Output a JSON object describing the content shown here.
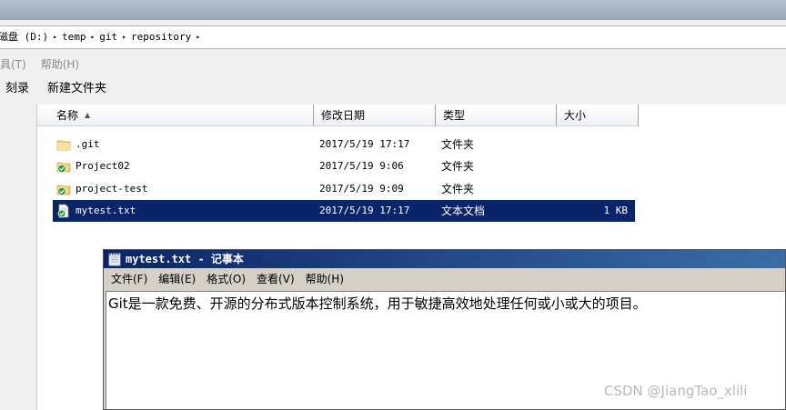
{
  "explorer": {
    "address": {
      "crumbs": [
        "磁盘 (D:)",
        "temp",
        "git",
        "repository"
      ],
      "separator": "▸"
    },
    "menu": [
      {
        "label": "具(T)"
      },
      {
        "label": "帮助(H)"
      }
    ],
    "toolbar": [
      {
        "label": "刻录"
      },
      {
        "label": "新建文件夹"
      }
    ],
    "columns": {
      "name": "名称",
      "date": "修改日期",
      "type": "类型",
      "size": "大小"
    },
    "files": [
      {
        "name": ".git",
        "date": "2017/5/19 17:17",
        "type": "文件夹",
        "size": "",
        "icon": "folder-icon",
        "selected": false
      },
      {
        "name": "Project02",
        "date": "2017/5/19 9:06",
        "type": "文件夹",
        "size": "",
        "icon": "git-folder-icon",
        "selected": false
      },
      {
        "name": "project-test",
        "date": "2017/5/19 9:09",
        "type": "文件夹",
        "size": "",
        "icon": "git-folder-icon",
        "selected": false
      },
      {
        "name": "mytest.txt",
        "date": "2017/5/19 17:17",
        "type": "文本文档",
        "size": "1 KB",
        "icon": "git-text-file-icon",
        "selected": true
      }
    ]
  },
  "notepad": {
    "title": "mytest.txt - 记事本",
    "menu": [
      "文件(F)",
      "编辑(E)",
      "格式(O)",
      "查看(V)",
      "帮助(H)"
    ],
    "content": "Git是一款免费、开源的分布式版本控制系统，用于敏捷高效地处理任何或小或大的项目。"
  },
  "watermark": "CSDN @JiangTao_xlili",
  "colors": {
    "selection": "#0a246a",
    "notepad_title_start": "#0a246a",
    "notepad_title_end": "#3a6ea5",
    "git_badge": "#2e9b2e"
  }
}
